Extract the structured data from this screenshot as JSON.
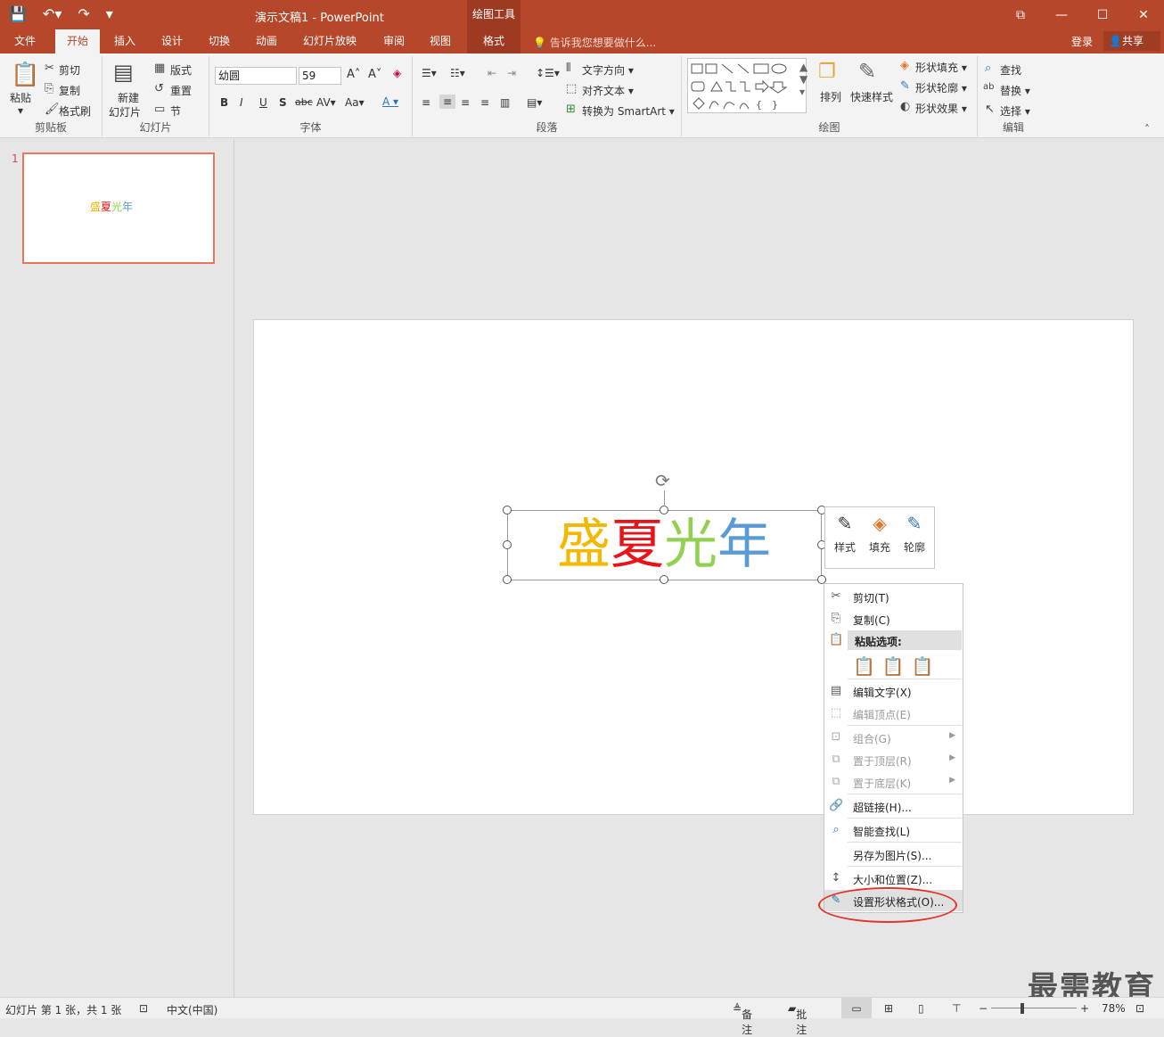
{
  "titlebar": {
    "title": "演示文稿1 - PowerPoint",
    "context_tab": "绘图工具",
    "qat": [
      "save-icon",
      "undo-icon",
      "redo-icon",
      "customize-icon"
    ],
    "window_buttons": [
      "ribbon-display-icon",
      "minimize-icon",
      "maximize-icon",
      "close-icon"
    ]
  },
  "tabs": [
    {
      "label": "文件"
    },
    {
      "label": "开始"
    },
    {
      "label": "插入"
    },
    {
      "label": "设计"
    },
    {
      "label": "切换"
    },
    {
      "label": "动画"
    },
    {
      "label": "幻灯片放映"
    },
    {
      "label": "审阅"
    },
    {
      "label": "视图"
    },
    {
      "label": "格式"
    }
  ],
  "tell_me": "告诉我您想要做什么...",
  "login": "登录",
  "share": "共享",
  "ribbon": {
    "clipboard": {
      "paste": "粘贴",
      "cut": "剪切",
      "copy": "复制",
      "format_painter": "格式刷",
      "label": "剪贴板"
    },
    "slides": {
      "new_slide_1": "新建",
      "new_slide_2": "幻灯片",
      "layout": "版式",
      "reset": "重置",
      "section": "节",
      "label": "幻灯片"
    },
    "font": {
      "name": "幼圆",
      "size": "59",
      "label": "字体"
    },
    "paragraph": {
      "text_direction": "文字方向",
      "align_text": "对齐文本",
      "convert_smartart": "转换为 SmartArt",
      "label": "段落"
    },
    "drawing": {
      "arrange": "排列",
      "quick_styles": "快速样式",
      "shape_fill": "形状填充",
      "shape_outline": "形状轮廓",
      "shape_effects": "形状效果",
      "label": "绘图"
    },
    "editing": {
      "find": "查找",
      "replace": "替换",
      "select": "选择",
      "label": "编辑"
    }
  },
  "thumbnail": {
    "number": "1",
    "text": "盛夏光年"
  },
  "slide_text": {
    "c1": "盛",
    "c2": "夏",
    "c3": "光",
    "c4": "年"
  },
  "colors": {
    "c1": "#f5b800",
    "c2": "#e8141a",
    "c3": "#92d050",
    "c4": "#5b9bd5",
    "accent": "#b7472a"
  },
  "mini_toolbar": {
    "style": "样式",
    "fill": "填充",
    "outline": "轮廓"
  },
  "context_menu": {
    "cut": "剪切(T)",
    "copy": "复制(C)",
    "paste_options": "粘贴选项:",
    "edit_text": "编辑文字(X)",
    "edit_points": "编辑顶点(E)",
    "group": "组合(G)",
    "bring_front": "置于顶层(R)",
    "send_back": "置于底层(K)",
    "hyperlink": "超链接(H)...",
    "smart_lookup": "智能查找(L)",
    "save_as_picture": "另存为图片(S)...",
    "size_position": "大小和位置(Z)...",
    "format_shape": "设置形状格式(O)..."
  },
  "status": {
    "slide_info": "幻灯片 第 1 张，共 1 张",
    "language": "中文(中国)",
    "notes": "备注",
    "comments": "批注",
    "zoom": "78%"
  },
  "watermark": "最需教育"
}
